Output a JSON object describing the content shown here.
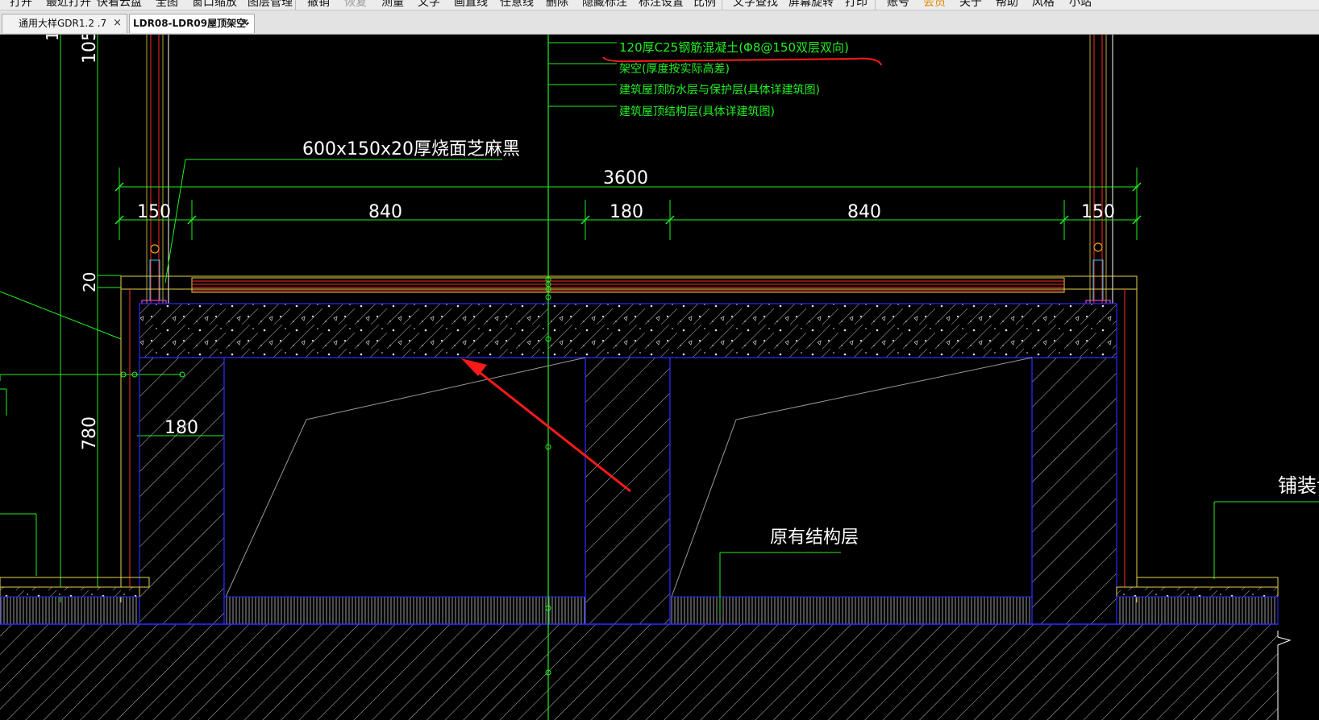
{
  "menubar": {
    "items": [
      {
        "label": "打开"
      },
      {
        "label": "最近打开"
      },
      {
        "label": "快看云盘"
      },
      {
        "label": "全图"
      },
      {
        "label": "窗口缩放"
      },
      {
        "label": "图层管理"
      },
      {
        "label": "撤销"
      },
      {
        "label": "恢复"
      },
      {
        "label": "测量"
      },
      {
        "label": "文字"
      },
      {
        "label": "画直线"
      },
      {
        "label": "任意线"
      },
      {
        "label": "删除"
      },
      {
        "label": "隐藏标注"
      },
      {
        "label": "标注设置"
      },
      {
        "label": "比例"
      },
      {
        "label": "文字查找"
      },
      {
        "label": "屏幕旋转"
      },
      {
        "label": "打印"
      },
      {
        "label": "账号"
      },
      {
        "label": "会员"
      },
      {
        "label": "关于"
      },
      {
        "label": "帮助"
      },
      {
        "label": "风格"
      },
      {
        "label": "小站"
      }
    ]
  },
  "tabs": [
    {
      "label": "通用大样GDR1.2 .7",
      "close": "×"
    },
    {
      "label": "LDR08-LDR09屋顶架空·",
      "close": "×"
    }
  ],
  "drawing": {
    "notes": [
      "120厚C25钢筋混凝土(Φ8@150双层双向)",
      "架空(厚度按实际高差)",
      "建筑屋顶防水层与保护层(具体详建筑图)",
      "建筑屋顶结构层(具体详建筑图)"
    ],
    "paving_label": "600x150x20厚烧面芝麻黑",
    "total_width": "3600",
    "segment_dims": [
      "150",
      "840",
      "180",
      "840",
      "150"
    ],
    "left_dim_top": "105",
    "left_dim_top_partial": "1",
    "thickness_dim": "20",
    "height_dim": "780",
    "pier_width_dim": "180",
    "original_structure_label": "原有结构层",
    "paving_detail_label": "铺装详"
  },
  "colors": {
    "green": "#22ee22",
    "blue": "#2a2aff",
    "red": "#ff2a2a",
    "yellow": "#e8d24a",
    "hatch": "#bfbfbf",
    "markup_red": "#ff1a1a"
  }
}
